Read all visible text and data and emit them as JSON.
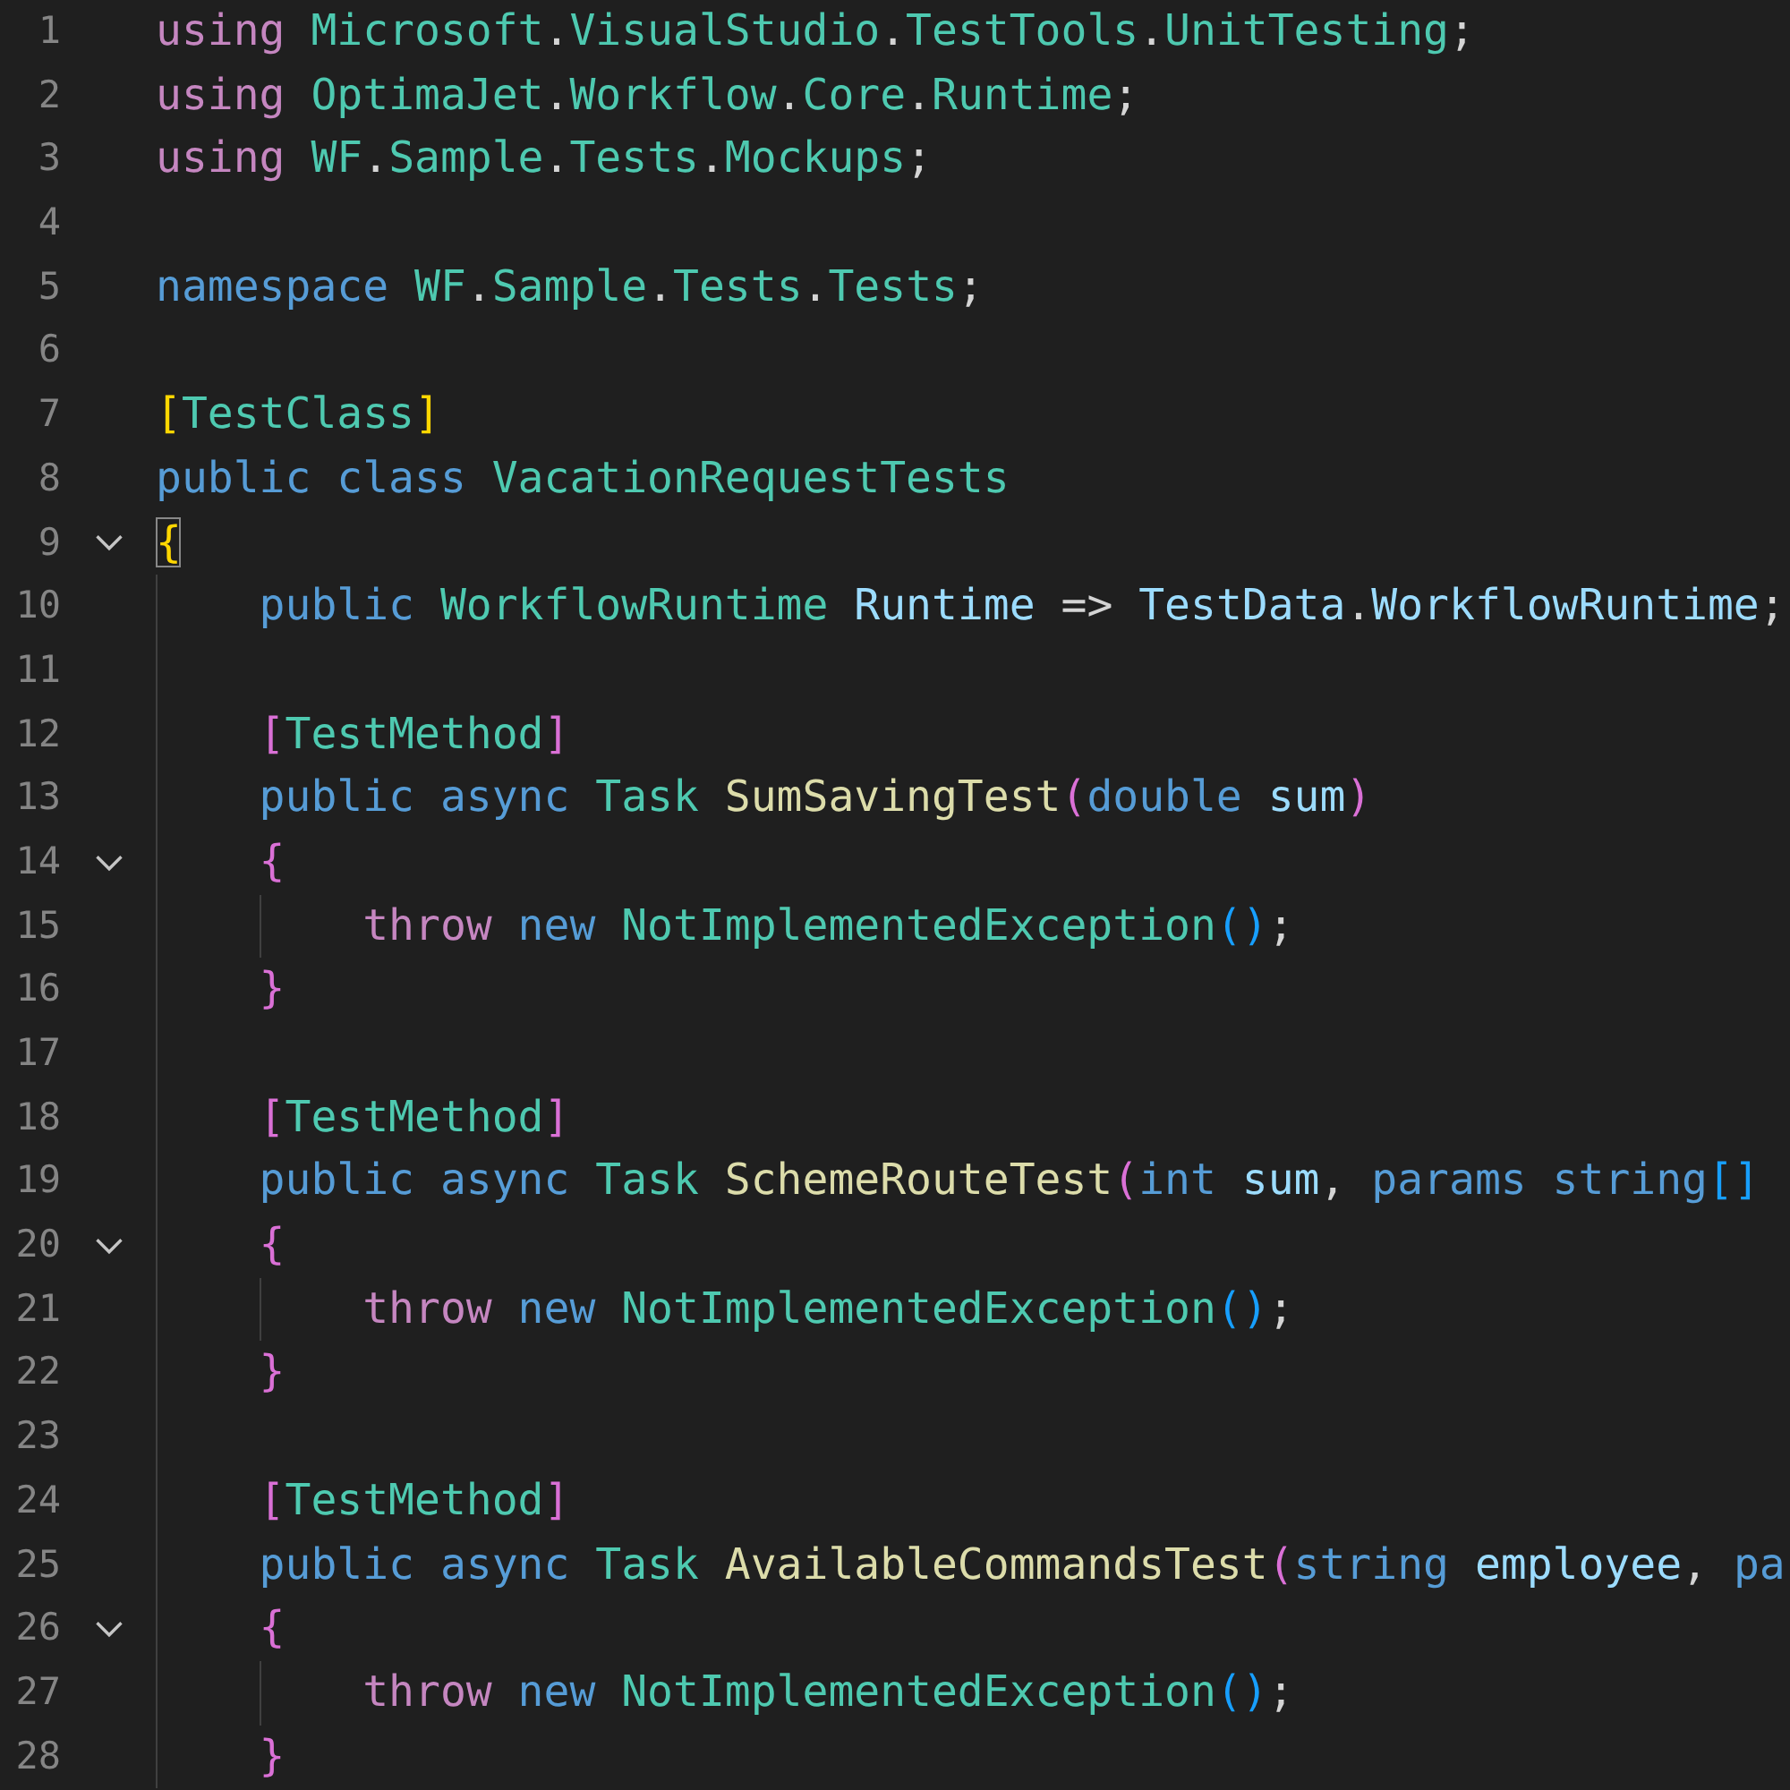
{
  "editor": {
    "lines": [
      {
        "number": "1",
        "tokens": [
          {
            "kind": "ctl",
            "text": "using "
          },
          {
            "kind": "type",
            "text": "Microsoft"
          },
          {
            "kind": "p",
            "text": "."
          },
          {
            "kind": "type",
            "text": "VisualStudio"
          },
          {
            "kind": "p",
            "text": "."
          },
          {
            "kind": "type",
            "text": "TestTools"
          },
          {
            "kind": "p",
            "text": "."
          },
          {
            "kind": "type",
            "text": "UnitTesting"
          },
          {
            "kind": "p",
            "text": ";"
          }
        ]
      },
      {
        "number": "2",
        "tokens": [
          {
            "kind": "ctl",
            "text": "using "
          },
          {
            "kind": "type",
            "text": "OptimaJet"
          },
          {
            "kind": "p",
            "text": "."
          },
          {
            "kind": "type",
            "text": "Workflow"
          },
          {
            "kind": "p",
            "text": "."
          },
          {
            "kind": "type",
            "text": "Core"
          },
          {
            "kind": "p",
            "text": "."
          },
          {
            "kind": "type",
            "text": "Runtime"
          },
          {
            "kind": "p",
            "text": ";"
          }
        ]
      },
      {
        "number": "3",
        "tokens": [
          {
            "kind": "ctl",
            "text": "using "
          },
          {
            "kind": "type",
            "text": "WF"
          },
          {
            "kind": "p",
            "text": "."
          },
          {
            "kind": "type",
            "text": "Sample"
          },
          {
            "kind": "p",
            "text": "."
          },
          {
            "kind": "type",
            "text": "Tests"
          },
          {
            "kind": "p",
            "text": "."
          },
          {
            "kind": "type",
            "text": "Mockups"
          },
          {
            "kind": "p",
            "text": ";"
          }
        ]
      },
      {
        "number": "4"
      },
      {
        "number": "5",
        "tokens": [
          {
            "kind": "kw",
            "text": "namespace "
          },
          {
            "kind": "type",
            "text": "WF"
          },
          {
            "kind": "p",
            "text": "."
          },
          {
            "kind": "type",
            "text": "Sample"
          },
          {
            "kind": "p",
            "text": "."
          },
          {
            "kind": "type",
            "text": "Tests"
          },
          {
            "kind": "p",
            "text": "."
          },
          {
            "kind": "type",
            "text": "Tests"
          },
          {
            "kind": "p",
            "text": ";"
          }
        ]
      },
      {
        "number": "6"
      },
      {
        "number": "7",
        "tokens": [
          {
            "kind": "b1",
            "text": "["
          },
          {
            "kind": "type",
            "text": "TestClass"
          },
          {
            "kind": "b1",
            "text": "]"
          }
        ]
      },
      {
        "number": "8",
        "tokens": [
          {
            "kind": "kw",
            "text": "public class "
          },
          {
            "kind": "type",
            "text": "VacationRequestTests"
          }
        ]
      },
      {
        "number": "9",
        "expanded": true,
        "tokens": [
          {
            "kind": "match",
            "text": "{"
          }
        ]
      },
      {
        "number": "10",
        "tokens": [
          {
            "kind": "kw",
            "text": "    public "
          },
          {
            "kind": "type",
            "text": "WorkflowRuntime "
          },
          {
            "kind": "var",
            "text": "Runtime"
          },
          {
            "kind": "p",
            "text": " => "
          },
          {
            "kind": "var",
            "text": "TestData"
          },
          {
            "kind": "p",
            "text": "."
          },
          {
            "kind": "var",
            "text": "WorkflowRuntime"
          },
          {
            "kind": "p",
            "text": ";"
          }
        ]
      },
      {
        "number": "11"
      },
      {
        "number": "12",
        "tokens": [
          {
            "kind": "b2",
            "text": "    ["
          },
          {
            "kind": "type",
            "text": "TestMethod"
          },
          {
            "kind": "b2",
            "text": "]"
          }
        ]
      },
      {
        "number": "13",
        "tokens": [
          {
            "kind": "kw",
            "text": "    public async "
          },
          {
            "kind": "type",
            "text": "Task "
          },
          {
            "kind": "fn",
            "text": "SumSavingTest"
          },
          {
            "kind": "b2",
            "text": "("
          },
          {
            "kind": "kw",
            "text": "double "
          },
          {
            "kind": "var",
            "text": "sum"
          },
          {
            "kind": "b2",
            "text": ")"
          }
        ]
      },
      {
        "number": "14",
        "expanded": true,
        "tokens": [
          {
            "kind": "b2",
            "text": "    {"
          }
        ]
      },
      {
        "number": "15",
        "tokens": [
          {
            "kind": "ctl",
            "text": "        throw "
          },
          {
            "kind": "kw",
            "text": "new "
          },
          {
            "kind": "type",
            "text": "NotImplementedException"
          },
          {
            "kind": "b3",
            "text": "()"
          },
          {
            "kind": "p",
            "text": ";"
          }
        ]
      },
      {
        "number": "16",
        "tokens": [
          {
            "kind": "b2",
            "text": "    }"
          }
        ]
      },
      {
        "number": "17"
      },
      {
        "number": "18",
        "tokens": [
          {
            "kind": "b2",
            "text": "    ["
          },
          {
            "kind": "type",
            "text": "TestMethod"
          },
          {
            "kind": "b2",
            "text": "]"
          }
        ]
      },
      {
        "number": "19",
        "tokens": [
          {
            "kind": "kw",
            "text": "    public async "
          },
          {
            "kind": "type",
            "text": "Task "
          },
          {
            "kind": "fn",
            "text": "SchemeRouteTest"
          },
          {
            "kind": "b2",
            "text": "("
          },
          {
            "kind": "kw",
            "text": "int "
          },
          {
            "kind": "var",
            "text": "sum"
          },
          {
            "kind": "p",
            "text": ", "
          },
          {
            "kind": "kw",
            "text": "params string"
          },
          {
            "kind": "b3",
            "text": "[]"
          }
        ]
      },
      {
        "number": "20",
        "expanded": true,
        "tokens": [
          {
            "kind": "b2",
            "text": "    {"
          }
        ]
      },
      {
        "number": "21",
        "tokens": [
          {
            "kind": "ctl",
            "text": "        throw "
          },
          {
            "kind": "kw",
            "text": "new "
          },
          {
            "kind": "type",
            "text": "NotImplementedException"
          },
          {
            "kind": "b3",
            "text": "()"
          },
          {
            "kind": "p",
            "text": ";"
          }
        ]
      },
      {
        "number": "22",
        "tokens": [
          {
            "kind": "b2",
            "text": "    }"
          }
        ]
      },
      {
        "number": "23"
      },
      {
        "number": "24",
        "tokens": [
          {
            "kind": "b2",
            "text": "    ["
          },
          {
            "kind": "type",
            "text": "TestMethod"
          },
          {
            "kind": "b2",
            "text": "]"
          }
        ]
      },
      {
        "number": "25",
        "tokens": [
          {
            "kind": "kw",
            "text": "    public async "
          },
          {
            "kind": "type",
            "text": "Task "
          },
          {
            "kind": "fn",
            "text": "AvailableCommandsTest"
          },
          {
            "kind": "b2",
            "text": "("
          },
          {
            "kind": "kw",
            "text": "string "
          },
          {
            "kind": "var",
            "text": "employee"
          },
          {
            "kind": "p",
            "text": ", "
          },
          {
            "kind": "kw",
            "text": "pa"
          }
        ]
      },
      {
        "number": "26",
        "expanded": true,
        "tokens": [
          {
            "kind": "b2",
            "text": "    {"
          }
        ]
      },
      {
        "number": "27",
        "tokens": [
          {
            "kind": "ctl",
            "text": "        throw "
          },
          {
            "kind": "kw",
            "text": "new "
          },
          {
            "kind": "type",
            "text": "NotImplementedException"
          },
          {
            "kind": "b3",
            "text": "()"
          },
          {
            "kind": "p",
            "text": ";"
          }
        ]
      },
      {
        "number": "28",
        "tokens": [
          {
            "kind": "b2",
            "text": "    }"
          }
        ]
      }
    ]
  }
}
